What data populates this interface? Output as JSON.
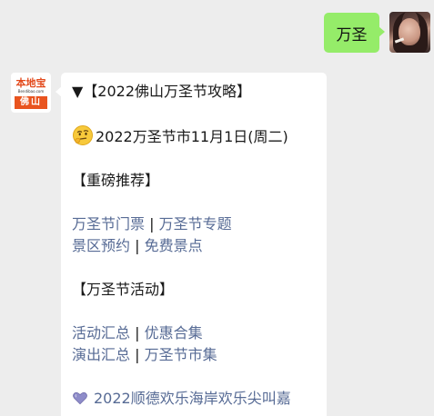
{
  "user_message": {
    "text": "万圣"
  },
  "bot_avatar": {
    "brand": "本地宝",
    "url": "Bendibao.com",
    "city": "佛山"
  },
  "bot_message": {
    "title": "▼【2022佛山万圣节攻略】",
    "date_line": "2022万圣节市11月1日(周二)",
    "section1_heading": "【重磅推荐】",
    "links_row1": [
      "万圣节门票",
      "万圣节专题"
    ],
    "links_row2": [
      "景区预约",
      "免费景点"
    ],
    "section2_heading": "【万圣节活动】",
    "links_row3": [
      "活动汇总",
      "优惠合集"
    ],
    "links_row4": [
      "演出汇总",
      "万圣节市集"
    ],
    "separator": "|",
    "last_line": "2022顺德欢乐海岸欢乐尖叫嘉",
    "icons": {
      "date_line": "thinking-face-icon",
      "last_line": "purple-heart-icon"
    }
  },
  "colors": {
    "background": "#ededed",
    "user_bubble": "#95ec69",
    "bot_bubble": "#ffffff",
    "link": "#576b95",
    "brand_accent": "#e34a1c"
  }
}
